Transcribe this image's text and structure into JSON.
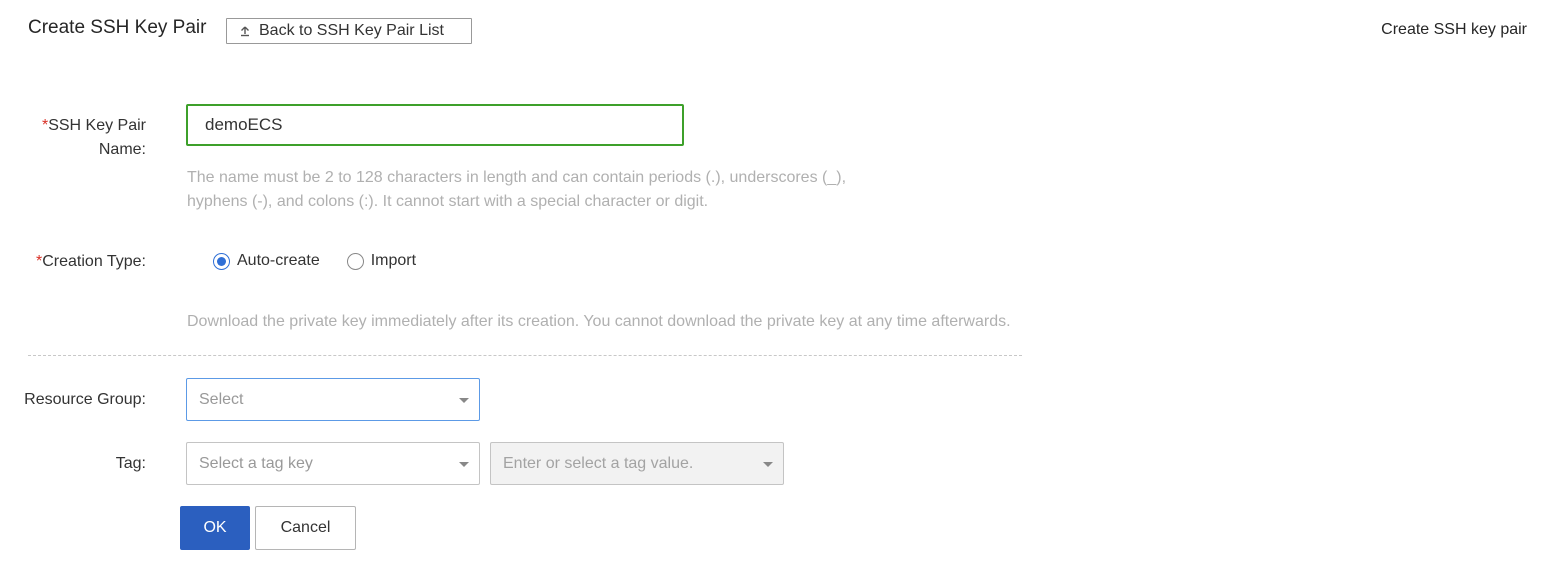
{
  "header": {
    "title": "Create SSH Key Pair",
    "back_label": "Back to SSH Key Pair List",
    "back_icon": "upload-arrow-icon",
    "top_right_link": "Create SSH key pair"
  },
  "form": {
    "name": {
      "required_mark": "*",
      "label_line1": "SSH Key Pair",
      "label_line2": "Name:",
      "value": "demoECS",
      "hint_line1": "The name must be 2 to 128 characters in length and can contain periods (.), underscores (_),",
      "hint_line2": "hyphens (-), and colons (:). It cannot start with a special character or digit."
    },
    "creation_type": {
      "required_mark": "*",
      "label": "Creation Type:",
      "options": [
        {
          "label": "Auto-create",
          "checked": true
        },
        {
          "label": "Import",
          "checked": false
        }
      ],
      "hint": "Download the private key immediately after its creation. You cannot download the private key at any time afterwards."
    },
    "resource_group": {
      "label": "Resource Group:",
      "placeholder": "Select"
    },
    "tag": {
      "label": "Tag:",
      "key_placeholder": "Select a tag key",
      "value_placeholder": "Enter or select a tag value."
    }
  },
  "actions": {
    "ok_label": "OK",
    "cancel_label": "Cancel"
  },
  "colors": {
    "primary": "#2b5fbf",
    "required": "#d93026",
    "valid_border": "#3da02a",
    "focus_border": "#5c9ae6",
    "radio": "#2f6fd6"
  }
}
